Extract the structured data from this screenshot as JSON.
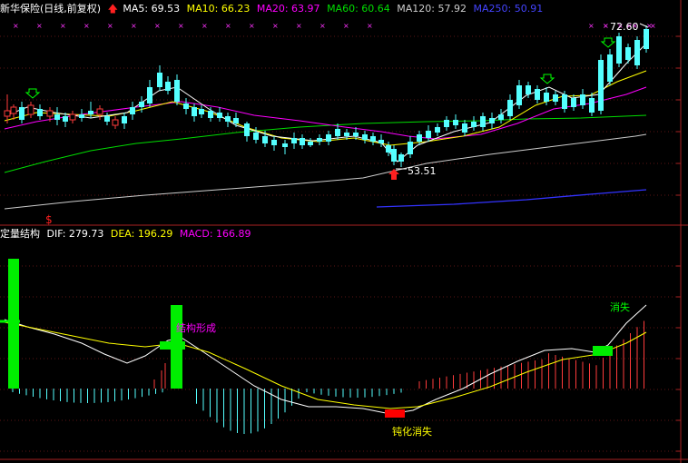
{
  "top_header": {
    "title": "新华保险(日线,前复权)",
    "ma5": "MA5: 69.53",
    "ma10": "MA10: 66.23",
    "ma20": "MA20: 63.97",
    "ma60": "MA60: 60.64",
    "ma120": "MA120: 57.92",
    "ma250": "MA250: 50.91"
  },
  "bottom_header": {
    "title": "定量结构",
    "dif": "DIF: 279.73",
    "dea": "DEA: 196.29",
    "macd": "MACD: 166.89"
  },
  "annotations": {
    "high_price": "72.60",
    "low_price": "53.51",
    "dollar": "$",
    "structure_formed": "结构形成",
    "disappear": "消失",
    "blunt_disappear": "钝化消失"
  },
  "colors": {
    "up": "#ff3b3b",
    "down": "#54ffff",
    "ma5": "#ffffff",
    "ma10": "#ffff00",
    "ma20": "#ff00ff",
    "ma60": "#00dd00",
    "ma120": "#cccccc",
    "ma250": "#3333ff",
    "signal_green": "#00ee00",
    "signal_red": "#ff0000"
  },
  "chart_data": [
    {
      "type": "candlestick",
      "title": "新华保险(日线,前复权)",
      "series": [
        {
          "name": "MA5",
          "value": 69.53
        },
        {
          "name": "MA10",
          "value": 66.23
        },
        {
          "name": "MA20",
          "value": 63.97
        },
        {
          "name": "MA60",
          "value": 60.64
        },
        {
          "name": "MA120",
          "value": 57.92
        },
        {
          "name": "MA250",
          "value": 50.91
        }
      ],
      "annotations": [
        "72.60",
        "53.51"
      ]
    },
    {
      "type": "bar",
      "title": "定量结构",
      "series": [
        {
          "name": "DIF",
          "value": 279.73
        },
        {
          "name": "DEA",
          "value": 196.29
        },
        {
          "name": "MACD",
          "value": 166.89
        }
      ]
    }
  ]
}
